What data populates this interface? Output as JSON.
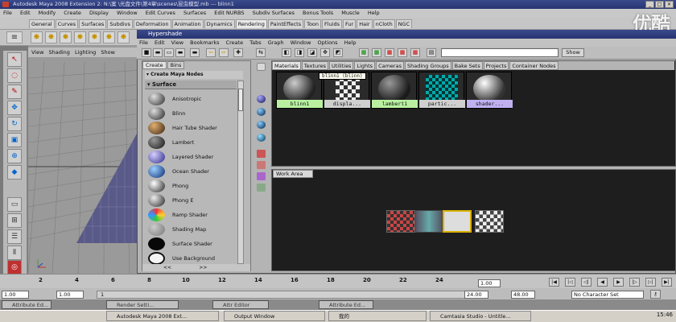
{
  "window_title": "Autodesk Maya 2008 Extension 2: N:\\案 \\光盘文件\\第4章\\scenes\\昆虫模型.mb  ---  blinn1",
  "main_menu": [
    "File",
    "Edit",
    "Modify",
    "Create",
    "Display",
    "Window",
    "Edit Curves",
    "Surfaces",
    "Edit NURBS",
    "Subdiv Surfaces",
    "Bonus Tools",
    "Muscle",
    "Help"
  ],
  "shelf_tabs": [
    "General",
    "Curves",
    "Surfaces",
    "Subdivs",
    "Deformation",
    "Animation",
    "Dynamics",
    "Rendering",
    "PaintEffects",
    "Toon",
    "Fluids",
    "Fur",
    "Hair",
    "nCloth",
    "NGC"
  ],
  "active_shelf": "Rendering",
  "watermark": "优酷",
  "viewport_menu": [
    "View",
    "Shading",
    "Lighting",
    "Show"
  ],
  "hypershade": {
    "title": "Hypershade",
    "menu": [
      "File",
      "Edit",
      "View",
      "Bookmarks",
      "Create",
      "Tabs",
      "Graph",
      "Window",
      "Options",
      "Help"
    ],
    "show_button": "Show",
    "search_value": "",
    "left_tabs": [
      "Create",
      "Bins"
    ],
    "create_header": "Create Maya Nodes",
    "category": "Surface",
    "shaders": [
      {
        "name": "Anisotropic",
        "color": "#5a5a5a"
      },
      {
        "name": "Blinn",
        "color": "#444"
      },
      {
        "name": "Hair Tube Shader",
        "color": "#8a5a2a"
      },
      {
        "name": "Lambert",
        "color": "#3a3a3a"
      },
      {
        "name": "Layered Shader",
        "color": "#6a6ab0"
      },
      {
        "name": "Ocean Shader",
        "color": "#2a5aa0"
      },
      {
        "name": "Phong",
        "color": "#555"
      },
      {
        "name": "Phong E",
        "color": "#505050"
      },
      {
        "name": "Ramp Shader",
        "color": "#c05030"
      },
      {
        "name": "Shading Map",
        "color": "#888"
      },
      {
        "name": "Surface Shader",
        "color": "#111"
      },
      {
        "name": "Use Background",
        "color": "#fff"
      }
    ],
    "left_bottom": "<<                  >>",
    "top_tabs": [
      "Materials",
      "Textures",
      "Utilities",
      "Lights",
      "Cameras",
      "Shading Groups",
      "Bake Sets",
      "Projects",
      "Container Nodes"
    ],
    "active_top_tab": "Materials",
    "materials": [
      {
        "label": "blinn1",
        "label_color": "#b8f0a0"
      },
      {
        "label": "displa...",
        "label_color": "#cfcfcf"
      },
      {
        "label": "lambert1",
        "label_color": "#b8f0a0"
      },
      {
        "label": "partic...",
        "label_color": "#cfcfcf"
      },
      {
        "label": "shader...",
        "label_color": "#c0b0f0"
      }
    ],
    "tooltip": "blinn1 (blinn)",
    "work_area_tab": "Work Area"
  },
  "timeline": {
    "ticks": [
      "2",
      "4",
      "6",
      "8",
      "10",
      "12",
      "14",
      "16",
      "18",
      "20",
      "22",
      "24"
    ],
    "current_frame": "1.00"
  },
  "range": {
    "start": "1.00",
    "start2": "1.00",
    "mid": "1",
    "end_a": "24.00",
    "end_b": "48.00",
    "character_set": "No Character Set"
  },
  "mini_windows": [
    "Attribute Ed...",
    "Render Setti...",
    "Attr Editor",
    "Attribute Ed..."
  ],
  "taskbar": [
    {
      "label": "Autodesk Maya 2008 Ext...",
      "active": true
    },
    {
      "label": "Output Window",
      "active": false
    },
    {
      "label": "我的",
      "active": false
    },
    {
      "label": "Camtasia Studio - Untitle...",
      "active": false
    }
  ],
  "clock": "15:46"
}
